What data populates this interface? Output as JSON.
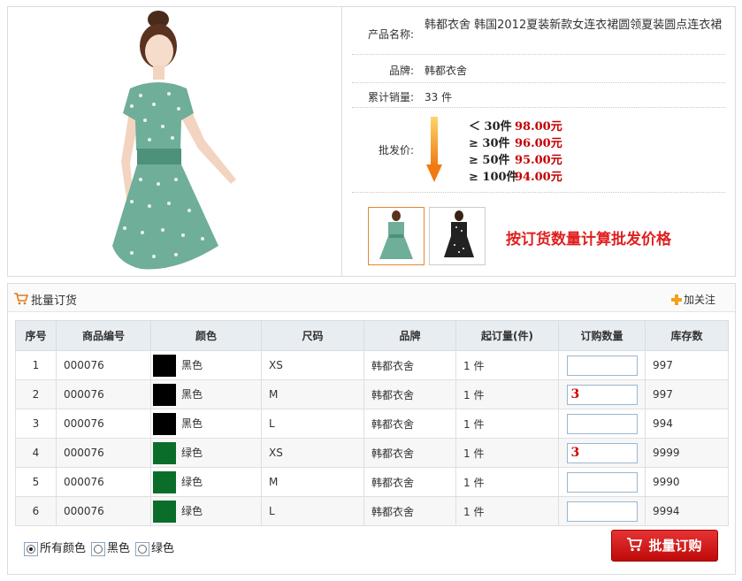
{
  "product": {
    "name_label": "产品名称:",
    "name": "韩都衣舍 韩国2012夏装新款女连衣裙圆领夏装圆点连衣裙",
    "brand_label": "品牌:",
    "brand": "韩都衣舍",
    "sales_label": "累计销量:",
    "sales": "33 件",
    "wholesale_label": "批发价:",
    "tiers": [
      {
        "qty": "＜ 30件",
        "price": "98.00元"
      },
      {
        "qty": "≥ 30件",
        "price": "96.00元"
      },
      {
        "qty": "≥ 50件",
        "price": "95.00元"
      },
      {
        "qty": "≥ 100件",
        "price": "94.00元"
      }
    ],
    "promo": "按订货数量计算批发价格",
    "colors": {
      "price": "#c40000",
      "promo": "#e02020",
      "accent": "#e38a2b"
    }
  },
  "bulk": {
    "title": "批量订货",
    "follow": "加关注",
    "columns": [
      "序号",
      "商品编号",
      "颜色",
      "尺码",
      "品牌",
      "起订量(件)",
      "订购数量",
      "库存数"
    ],
    "rows": [
      {
        "no": "1",
        "code": "000076",
        "color": "黑色",
        "swatch": "#000000",
        "size": "XS",
        "brand": "韩都衣舍",
        "min": "1 件",
        "qty": "",
        "stock": "997"
      },
      {
        "no": "2",
        "code": "000076",
        "color": "黑色",
        "swatch": "#000000",
        "size": "M",
        "brand": "韩都衣舍",
        "min": "1 件",
        "qty": "3",
        "stock": "997"
      },
      {
        "no": "3",
        "code": "000076",
        "color": "黑色",
        "swatch": "#000000",
        "size": "L",
        "brand": "韩都衣舍",
        "min": "1 件",
        "qty": "",
        "stock": "994"
      },
      {
        "no": "4",
        "code": "000076",
        "color": "绿色",
        "swatch": "#0a6e2a",
        "size": "XS",
        "brand": "韩都衣舍",
        "min": "1 件",
        "qty": "3",
        "stock": "9999"
      },
      {
        "no": "5",
        "code": "000076",
        "color": "绿色",
        "swatch": "#0a6e2a",
        "size": "M",
        "brand": "韩都衣舍",
        "min": "1 件",
        "qty": "",
        "stock": "9990"
      },
      {
        "no": "6",
        "code": "000076",
        "color": "绿色",
        "swatch": "#0a6e2a",
        "size": "L",
        "brand": "韩都衣舍",
        "min": "1 件",
        "qty": "",
        "stock": "9994"
      }
    ],
    "filters": [
      {
        "label": "所有颜色",
        "checked": true
      },
      {
        "label": "黑色",
        "checked": false
      },
      {
        "label": "绿色",
        "checked": false
      }
    ],
    "buy_label": "批量订购"
  }
}
